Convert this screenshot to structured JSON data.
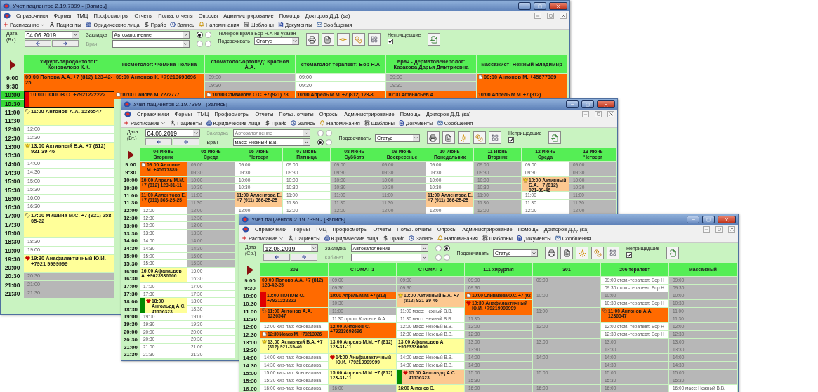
{
  "windows": [
    {
      "title": "Учет пациентов 2.19.7399 - [Запись]",
      "menu": [
        "Справочники",
        "Формы",
        "ТМЦ",
        "Профосмотры",
        "Отчеты",
        "Польз. отчеты",
        "Опросы",
        "Администрирование",
        "Помощь",
        "Докторов Д.Д. (sa)"
      ],
      "toolbar": [
        "Расписание",
        "Пациенты",
        "Юридические лица",
        "Прайс",
        "Запись",
        "Напоминания",
        "Шаблоны",
        "Документы",
        "Сообщения"
      ],
      "filter": {
        "date_label": "Дата",
        "weekday": "(Вт.)",
        "date": "04.06.2019",
        "fields": [
          {
            "label": "Закладка",
            "value": "Автозаполнение",
            "disabled": false
          },
          {
            "label": "Врач",
            "disabled": true
          }
        ],
        "radios": [
          [
            {
              "selected": true
            },
            {
              "selected": false
            }
          ],
          [
            {
              "selected": false
            },
            {
              "selected": false
            }
          ]
        ],
        "phone_note": "Телефон врача Бор Н.А не указан",
        "highlight_label": "Подсвечивать",
        "highlight_value": "Статус",
        "absent": {
          "label": "Неприщедшие",
          "checked": true
        }
      },
      "times": [
        {
          "t": "9:00",
          "selected": false
        },
        {
          "t": "9:30",
          "selected": false
        },
        {
          "t": "10:00",
          "selected": true
        },
        {
          "t": "10:30",
          "selected": true
        },
        {
          "t": "11:00",
          "selected": false
        },
        {
          "t": "11:30",
          "selected": false
        },
        {
          "t": "12:00",
          "selected": false
        },
        {
          "t": "12:30",
          "selected": false
        },
        {
          "t": "13:00",
          "selected": false
        },
        {
          "t": "13:30",
          "selected": false
        },
        {
          "t": "14:00",
          "selected": false
        },
        {
          "t": "14:30",
          "selected": false
        },
        {
          "t": "15:00",
          "selected": false
        },
        {
          "t": "15:30",
          "selected": false
        },
        {
          "t": "16:00",
          "selected": false
        },
        {
          "t": "16:30",
          "selected": false
        },
        {
          "t": "17:00",
          "selected": false
        },
        {
          "t": "17:30",
          "selected": false
        },
        {
          "t": "18:00",
          "selected": false
        },
        {
          "t": "18:30",
          "selected": false
        },
        {
          "t": "19:00",
          "selected": false
        },
        {
          "t": "19:30",
          "selected": false
        },
        {
          "t": "20:00",
          "selected": false
        },
        {
          "t": "20:30",
          "selected": false
        },
        {
          "t": "21:00",
          "selected": false
        },
        {
          "t": "21:30",
          "selected": false
        }
      ],
      "columns": [
        {
          "header": [
            "хирург-пародонтолог: Коновалова К.К."
          ],
          "cells": [
            {
              "kind": "visit",
              "text": "09:00 Попова А.А. +7 (812) 123-42-25",
              "color": "#ff6a00",
              "selected": false
            },
            {
              "kind": "visit",
              "text": "10:00 ПОПОВ О. +7921222222",
              "color": "#ff6a00",
              "selected": true,
              "flag": {
                "color": "#e00000"
              }
            },
            {
              "kind": "visit",
              "text": "11:00 Антонов А.А. 1236547",
              "color": "#ffff99",
              "selected": false,
              "tagged": true
            },
            {
              "kind": "free",
              "text": "12:00"
            },
            {
              "kind": "free",
              "text": "12:30"
            },
            {
              "kind": "visit",
              "text": "13:00 Активный Б.А. +7 (812) 921-39-46",
              "color": "#ffff99",
              "selected": false,
              "vip": true
            },
            {
              "kind": "free",
              "text": "14:00"
            },
            {
              "kind": "free",
              "text": "14:30"
            },
            {
              "kind": "free",
              "text": "15:00"
            },
            {
              "kind": "free",
              "text": "15:30"
            },
            {
              "kind": "free",
              "text": "16:00"
            },
            {
              "kind": "free",
              "text": "16:30"
            },
            {
              "kind": "visit-long",
              "text": "17:00 Мишина М.С. +7 (921) 258-05-22",
              "color": "#ffff99",
              "selected": false,
              "tagged": true
            },
            {
              "kind": "free",
              "text": "18:30"
            },
            {
              "kind": "free",
              "text": "19:00"
            },
            {
              "kind": "visit",
              "text": "19:30 Анафилактичный Ю.И. +7921 9999999",
              "color": "#ffff99",
              "selected": false,
              "allergy": true
            },
            {
              "kind": "closed",
              "text": "20:30"
            },
            {
              "kind": "closed",
              "text": "21:00"
            },
            {
              "kind": "closed",
              "text": "21:30"
            }
          ]
        },
        {
          "header": [
            "косметолог: Фомина Полина"
          ],
          "cells": [
            {
              "kind": "visit",
              "text": "09:00 Антонов К. +79213693696",
              "color": "#ff6a00",
              "selected": false
            },
            {
              "kind": "visit-half",
              "text": "10:00 Панова М. 7272777",
              "color": "#ff6a00",
              "selected": false,
              "noted": true
            }
          ]
        },
        {
          "header": [
            "стоматолог-ортопед: Краснов А.А."
          ],
          "cells": [
            {
              "kind": "closed",
              "text": "09:00"
            },
            {
              "kind": "closed",
              "text": "09:30"
            },
            {
              "kind": "visit-half",
              "text": "10:00 Спивакова О.С. +7 (921) 78",
              "color": "#ff6a00",
              "selected": false,
              "noted": true
            }
          ]
        },
        {
          "header": [
            "стоматолог-терапевт: Бор Н.А"
          ],
          "cells": [
            {
              "kind": "free",
              "text": "09:00"
            },
            {
              "kind": "free",
              "text": "09:30"
            },
            {
              "kind": "visit-half",
              "text": "10:00 Апрель М.М. +7 (812) 123-3",
              "color": "#ff6a00",
              "selected": false
            }
          ]
        },
        {
          "header": [
            "врач - дерматовенеролог: Казакова Дарья Дмитриевна"
          ],
          "cells": [
            {
              "kind": "closed",
              "text": "09:00"
            },
            {
              "kind": "closed",
              "text": "09:30"
            },
            {
              "kind": "visit-half",
              "text": "10:00 Афанасьев А.",
              "color": "#ff6a00",
              "selected": false
            }
          ]
        },
        {
          "header": [
            "массажист: Нежный Владимир"
          ],
          "cells": [
            {
              "kind": "visit",
              "text": "09:00 Антонов М. +45677889",
              "color": "#ff6a00",
              "selected": false,
              "noted": true
            },
            {
              "kind": "visit-half",
              "text": "10:00 Апрель М.М. +7 (812)",
              "color": "#ff6a00",
              "selected": false
            }
          ]
        }
      ]
    },
    {
      "title": "Учет пациентов 2.19.7399 - [Запись]",
      "menu": [
        "Справочники",
        "Формы",
        "ТМЦ",
        "Профосмотры",
        "Отчеты",
        "Польз. отчеты",
        "Опросы",
        "Администрирование",
        "Помощь",
        "Докторов Д.Д. (sa)"
      ],
      "toolbar": [
        "Расписание",
        "Пациенты",
        "Юридические лица",
        "Прайс",
        "Запись",
        "Напоминания",
        "Шаблоны",
        "Документы",
        "Сообщения"
      ],
      "filter": {
        "date_label": "Дата",
        "weekday": "(Вт.)",
        "date": "04.06.2019",
        "fields": [
          {
            "label": "Закладка",
            "value": "Автозаполнение",
            "disabled": true
          },
          {
            "label": "Врач",
            "value": "масс: Нежный В.В.",
            "disabled": false
          }
        ],
        "radios": [
          [
            {
              "selected": false
            },
            {
              "selected": false
            }
          ],
          [
            {
              "selected": true
            },
            {
              "selected": false
            }
          ]
        ],
        "highlight_label": "Подсвечивать",
        "highlight_value": "Статус",
        "absent": {
          "label": "Неприщедшие",
          "checked": true
        }
      },
      "times": [
        {
          "t": "9:00",
          "selected": false
        },
        {
          "t": "9:30",
          "selected": false
        },
        {
          "t": "10:00",
          "selected": false
        },
        {
          "t": "10:30",
          "selected": false
        },
        {
          "t": "11:00",
          "selected": false
        },
        {
          "t": "11:30",
          "selected": false
        },
        {
          "t": "12:00",
          "selected": false
        },
        {
          "t": "12:30",
          "selected": false
        },
        {
          "t": "13:00",
          "selected": false
        },
        {
          "t": "13:30",
          "selected": false
        },
        {
          "t": "14:00",
          "selected": false
        },
        {
          "t": "14:30",
          "selected": false
        },
        {
          "t": "15:00",
          "selected": false
        },
        {
          "t": "15:30",
          "selected": false
        },
        {
          "t": "16:00",
          "selected": false
        },
        {
          "t": "16:30",
          "selected": false
        },
        {
          "t": "17:00",
          "selected": false
        },
        {
          "t": "17:30",
          "selected": false
        },
        {
          "t": "18:00",
          "selected": false
        },
        {
          "t": "18:30",
          "selected": false
        },
        {
          "t": "19:00",
          "selected": false
        },
        {
          "t": "19:30",
          "selected": false
        },
        {
          "t": "20:00",
          "selected": false
        },
        {
          "t": "20:30",
          "selected": false
        },
        {
          "t": "21:00",
          "selected": false
        },
        {
          "t": "21:30",
          "selected": false
        }
      ],
      "columns": [
        {
          "header": [
            "04 Июнь",
            "Вторник"
          ],
          "cells": [
            {
              "kind": "visit",
              "text": "09:00 Антонов М. +45677889",
              "color": "#ff6a00",
              "selected": false,
              "noted": true
            },
            {
              "kind": "visit",
              "text": "10:00 Апрель М.М. +7 (812) 123-31-11",
              "color": "#ff6a00",
              "selected": false
            },
            {
              "kind": "visit",
              "text": "11:00 Аллентова Е. +7 (911) 366-25-25",
              "color": "#ff6a00",
              "selected": false
            },
            {
              "kind": "free",
              "text": "12:00"
            },
            {
              "kind": "free",
              "text": "12:30"
            },
            {
              "kind": "free",
              "text": "13:00"
            },
            {
              "kind": "free",
              "text": "13:30"
            },
            {
              "kind": "free",
              "text": "14:00"
            },
            {
              "kind": "free",
              "text": "14:30"
            },
            {
              "kind": "free",
              "text": "15:00"
            },
            {
              "kind": "free",
              "text": "15:30"
            },
            {
              "kind": "visit",
              "text": "16:00 Афанасьев А. +9623336666",
              "color": "#ffff99",
              "selected": false
            },
            {
              "kind": "free",
              "text": "17:00"
            },
            {
              "kind": "free",
              "text": "17:30"
            },
            {
              "kind": "visit",
              "text": "18:00 Ангольдц А.С. 41156323",
              "color": "#ffff99",
              "selected": false,
              "allergy": true,
              "flag": {
                "color": "#008a00"
              }
            },
            {
              "kind": "free",
              "text": "19:00"
            },
            {
              "kind": "free",
              "text": "19:30"
            },
            {
              "kind": "free",
              "text": "20:00"
            },
            {
              "kind": "free",
              "text": "20:30"
            },
            {
              "kind": "free",
              "text": "21:00"
            },
            {
              "kind": "free",
              "text": "21:30"
            }
          ]
        },
        {
          "header": [
            "05 Июнь",
            "Среда"
          ],
          "cells": [
            {
              "kind": "closed",
              "text": "09:00"
            },
            {
              "kind": "closed",
              "text": "09:30"
            },
            {
              "kind": "closed",
              "text": "10:00"
            },
            {
              "kind": "closed",
              "text": "10:30"
            },
            {
              "kind": "closed",
              "text": "11:00"
            },
            {
              "kind": "closed",
              "text": "11:30"
            },
            {
              "kind": "closed",
              "text": "12:00"
            },
            {
              "kind": "closed",
              "text": "12:30"
            },
            {
              "kind": "closed",
              "text": "13:00"
            },
            {
              "kind": "closed",
              "text": "13:30"
            },
            {
              "kind": "closed",
              "text": "14:00"
            },
            {
              "kind": "closed",
              "text": "14:30"
            },
            {
              "kind": "closed",
              "text": "15:00"
            },
            {
              "kind": "closed",
              "text": "15:30"
            },
            {
              "kind": "free",
              "text": "16:00"
            },
            {
              "kind": "free",
              "text": "16:30"
            },
            {
              "kind": "free",
              "text": "17:00"
            },
            {
              "kind": "free",
              "text": "17:30"
            },
            {
              "kind": "free",
              "text": "18:00"
            },
            {
              "kind": "free",
              "text": "18:30"
            },
            {
              "kind": "free",
              "text": "19:00"
            },
            {
              "kind": "free",
              "text": "19:30"
            },
            {
              "kind": "free",
              "text": "20:00"
            },
            {
              "kind": "free",
              "text": "20:30"
            },
            {
              "kind": "free",
              "text": "21:00"
            },
            {
              "kind": "free",
              "text": "21:30"
            }
          ]
        },
        {
          "header": [
            "06 Июнь",
            "Четверг"
          ],
          "cells": [
            {
              "kind": "free",
              "text": "09:00"
            },
            {
              "kind": "free",
              "text": "09:30"
            },
            {
              "kind": "free",
              "text": "10:00"
            },
            {
              "kind": "free",
              "text": "10:30"
            },
            {
              "kind": "visit",
              "text": "11:00 Аллентова Е. +7 (911) 366-25-25",
              "color": "#fcc890",
              "selected": false
            },
            {
              "kind": "free",
              "text": "12:00"
            }
          ]
        },
        {
          "header": [
            "07 Июнь",
            "Пятница"
          ],
          "cells": [
            {
              "kind": "free",
              "text": "09:00"
            },
            {
              "kind": "free",
              "text": "09:30"
            },
            {
              "kind": "free",
              "text": "10:00"
            },
            {
              "kind": "free",
              "text": "10:30"
            },
            {
              "kind": "free",
              "text": "11:00"
            },
            {
              "kind": "free",
              "text": "11:30"
            },
            {
              "kind": "free",
              "text": "12:00"
            }
          ]
        },
        {
          "header": [
            "08 Июнь",
            "Суббота"
          ],
          "cells": [
            {
              "kind": "closed",
              "text": "09:00"
            },
            {
              "kind": "closed",
              "text": "09:30"
            },
            {
              "kind": "closed",
              "text": "10:00"
            },
            {
              "kind": "closed",
              "text": "10:30"
            },
            {
              "kind": "closed",
              "text": "11:00"
            },
            {
              "kind": "closed",
              "text": "11:30"
            },
            {
              "kind": "closed",
              "text": "12:00"
            }
          ]
        },
        {
          "header": [
            "09 Июнь",
            "Воскресенье"
          ],
          "cells": [
            {
              "kind": "closed",
              "text": "09:00"
            },
            {
              "kind": "closed",
              "text": "09:30"
            },
            {
              "kind": "closed",
              "text": "10:00"
            },
            {
              "kind": "closed",
              "text": "10:30"
            },
            {
              "kind": "closed",
              "text": "11:00"
            },
            {
              "kind": "closed",
              "text": "11:30"
            },
            {
              "kind": "closed",
              "text": "12:00"
            }
          ]
        },
        {
          "header": [
            "10 Июнь",
            "Понедельник"
          ],
          "cells": [
            {
              "kind": "free",
              "text": "09:00"
            },
            {
              "kind": "free",
              "text": "09:30"
            },
            {
              "kind": "free",
              "text": "10:00"
            },
            {
              "kind": "free",
              "text": "10:30"
            },
            {
              "kind": "visit",
              "text": "11:00 Аллентова Е. +7 (911) 366-25-25",
              "color": "#fcc890",
              "selected": false
            },
            {
              "kind": "free",
              "text": "12:00"
            }
          ]
        },
        {
          "header": [
            "11 Июнь",
            "Вторник"
          ],
          "cells": [
            {
              "kind": "closed",
              "text": "09:00"
            },
            {
              "kind": "closed",
              "text": "09:30"
            },
            {
              "kind": "closed",
              "text": "10:00"
            },
            {
              "kind": "closed",
              "text": "10:30"
            },
            {
              "kind": "closed",
              "text": "11:00"
            },
            {
              "kind": "closed",
              "text": "11:30"
            },
            {
              "kind": "closed",
              "text": "12:00"
            }
          ]
        },
        {
          "header": [
            "12 Июнь",
            "Среда"
          ],
          "cells": [
            {
              "kind": "free",
              "text": "09:00"
            },
            {
              "kind": "free",
              "text": "09:30"
            },
            {
              "kind": "visit",
              "text": "10:00 Активный Б.А. +7 (812) 921-39-46",
              "color": "#fcc890",
              "selected": false,
              "vip": true
            },
            {
              "kind": "free",
              "text": "11:00"
            },
            {
              "kind": "free",
              "text": "11:30"
            },
            {
              "kind": "free",
              "text": "12:00"
            }
          ]
        },
        {
          "header": [
            "13 Июнь",
            "Четверг"
          ],
          "cells": [
            {
              "kind": "closed",
              "text": "09:00"
            },
            {
              "kind": "closed",
              "text": "09:30"
            },
            {
              "kind": "closed",
              "text": "10:00"
            },
            {
              "kind": "closed",
              "text": "10:30"
            },
            {
              "kind": "closed",
              "text": "11:00"
            },
            {
              "kind": "closed",
              "text": "11:30"
            },
            {
              "kind": "closed",
              "text": "12:00"
            }
          ]
        }
      ]
    },
    {
      "title": "Учет пациентов 2.19.7399 - [Запись]",
      "menu": [
        "Справочники",
        "Формы",
        "ТМЦ",
        "Профосмотры",
        "Отчеты",
        "Польз. отчеты",
        "Опросы",
        "Администрирование",
        "Помощь",
        "Докторов Д.Д. (sa)"
      ],
      "toolbar": [
        "Расписание",
        "Пациенты",
        "Юридические лица",
        "Прайс",
        "Запись",
        "Напоминания",
        "Шаблоны",
        "Документы",
        "Сообщения"
      ],
      "filter": {
        "date_label": "Дата",
        "weekday": "(Ср.)",
        "date": "12.06.2019",
        "fields": [
          {
            "label": "Закладка",
            "value": "Автозаполнение",
            "disabled": false
          },
          {
            "label": "Кабинет",
            "disabled": true
          }
        ],
        "radios": [
          [
            {
              "selected": false
            },
            {
              "selected": true
            }
          ],
          [
            {
              "selected": false
            },
            {
              "selected": false
            }
          ]
        ],
        "highlight_label": "Подсвечивать",
        "highlight_value": "Статус",
        "absent": {
          "label": "Неприщедшие",
          "checked": true
        }
      },
      "times": [
        {
          "t": "9:00",
          "selected": false
        },
        {
          "t": "9:30",
          "selected": false
        },
        {
          "t": "10:00",
          "selected": false
        },
        {
          "t": "10:30",
          "selected": false
        },
        {
          "t": "11:00",
          "selected": false
        },
        {
          "t": "11:30",
          "selected": false
        },
        {
          "t": "12:00",
          "selected": false
        },
        {
          "t": "12:30",
          "selected": false
        },
        {
          "t": "13:00",
          "selected": false
        },
        {
          "t": "13:30",
          "selected": false
        },
        {
          "t": "14:00",
          "selected": false
        },
        {
          "t": "14:30",
          "selected": false
        },
        {
          "t": "15:00",
          "selected": false
        },
        {
          "t": "15:30",
          "selected": false
        },
        {
          "t": "16:00",
          "selected": false
        }
      ],
      "columns": [
        {
          "header": [
            "203"
          ],
          "cells": [
            {
              "kind": "visit",
              "text": "09:00 Попова А.А. +7 (812) 123-42-25",
              "color": "#ff6a00",
              "selected": false
            },
            {
              "kind": "visit",
              "text": "10:00 ПОПОВ О. +7921222222",
              "color": "#ff6a00",
              "selected": false,
              "flag": {
                "color": "#e00000"
              }
            },
            {
              "kind": "visit",
              "text": "11:00 Антонов А.А. 1236547",
              "color": "#ff6a00",
              "selected": false,
              "tagged": true
            },
            {
              "kind": "free",
              "text": "12:00 хир-пар: Коновалова"
            },
            {
              "kind": "visit-half",
              "text": "12:30 Исаев М. +79213926",
              "color": "#ff6a00",
              "selected": false,
              "noted": true
            },
            {
              "kind": "visit",
              "text": "13:00 Активный Б.А. +7 (812) 921-39-46",
              "color": "#ffff99",
              "selected": false,
              "vip": true
            },
            {
              "kind": "free",
              "text": "14:00 хир-пар: Коновалова"
            },
            {
              "kind": "free",
              "text": "14:30 хир-пар: Коновалова"
            },
            {
              "kind": "free",
              "text": "15:00 хир-пар: Коновалова"
            },
            {
              "kind": "free",
              "text": "15:30 хир-пар: Коновалова"
            },
            {
              "kind": "free",
              "text": "16:00 хир-пар: Коновалова"
            }
          ]
        },
        {
          "header": [
            "СТОМАТ 1"
          ],
          "cells": [
            {
              "kind": "closed",
              "text": "09:00"
            },
            {
              "kind": "closed",
              "text": "09:30"
            },
            {
              "kind": "visit-half",
              "text": "10:00 Апрель М.М. +7 (812)",
              "color": "#ff6a00",
              "selected": false
            },
            {
              "kind": "closed",
              "text": "10:30"
            },
            {
              "kind": "closed",
              "text": "11:00"
            },
            {
              "kind": "free",
              "text": "11:30 ортоп: Краснов А.А."
            },
            {
              "kind": "visit",
              "text": "12:00 Антонов С. +79213693696",
              "color": "#ff6a00",
              "selected": false
            },
            {
              "kind": "visit",
              "text": "13:00 Апрель М.М. +7 (812) 123-31-11",
              "color": "#ffff99",
              "selected": false
            },
            {
              "kind": "visit",
              "text": "14:00 Анафилактичный Ю.И. +79219999999",
              "color": "#ffff99",
              "selected": false,
              "allergy": true
            },
            {
              "kind": "visit",
              "text": "15:00 Апрель М.М. +7 (812) 123-31-11",
              "color": "#ffff99",
              "selected": false
            },
            {
              "kind": "closed",
              "text": "16:00"
            }
          ]
        },
        {
          "header": [
            "СТОМАТ 2"
          ],
          "cells": [
            {
              "kind": "closed",
              "text": "09:00"
            },
            {
              "kind": "closed",
              "text": "09:30"
            },
            {
              "kind": "visit",
              "text": "10:00 Активный Б.А. +7 (812) 921-39-46",
              "color": "#fcc890",
              "selected": false,
              "vip": true
            },
            {
              "kind": "free",
              "text": "11:00 масс: Нежный В.В."
            },
            {
              "kind": "free",
              "text": "11:30 масс: Нежный В.В."
            },
            {
              "kind": "free",
              "text": "12:00 масс: Нежный В.В."
            },
            {
              "kind": "free",
              "text": "12:30 масс: Нежный В.В."
            },
            {
              "kind": "visit",
              "text": "13:00 Афанасьев А. +9623336666",
              "color": "#ffff99",
              "selected": false
            },
            {
              "kind": "free",
              "text": "14:00 масс: Нежный В.В."
            },
            {
              "kind": "free",
              "text": "14:30 масс: Нежный В.В."
            },
            {
              "kind": "visit",
              "text": "15:00 Ангольдц А.С. 41156323",
              "color": "#fcc890",
              "selected": false,
              "allergy": true,
              "flag": {
                "color": "#008a00"
              }
            },
            {
              "kind": "visit-half",
              "text": "16:00 Антонов С.",
              "color": "#ffff99",
              "selected": false
            }
          ]
        },
        {
          "header": [
            "111-хирургия"
          ],
          "cells": [
            {
              "kind": "closed",
              "text": "09:00"
            },
            {
              "kind": "closed",
              "text": "09:30"
            },
            {
              "kind": "visit-half",
              "text": "10:00 Спивакова О.С. +7 (92",
              "color": "#ff6a00",
              "selected": false,
              "noted": true
            },
            {
              "kind": "visit",
              "text": "10:30 Анафилактичный Ю.И. +79219999999",
              "color": "#ff6a00",
              "selected": false,
              "allergy": true
            },
            {
              "kind": "closed",
              "text": "11:30"
            },
            {
              "kind": "closed",
              "text": "12:00"
            },
            {
              "kind": "closed",
              "text": "12:30"
            },
            {
              "kind": "closed",
              "text": "13:00"
            },
            {
              "kind": "closed",
              "text": "13:30"
            },
            {
              "kind": "closed",
              "text": "14:00"
            },
            {
              "kind": "closed",
              "text": "14:30"
            },
            {
              "kind": "closed",
              "text": "15:00"
            },
            {
              "kind": "closed",
              "text": "15:30"
            },
            {
              "kind": "closed",
              "text": "16:00"
            }
          ]
        },
        {
          "header": [
            "301"
          ],
          "cells": [
            {
              "kind": "closed-hour",
              "text": "09:00"
            },
            {
              "kind": "closed-hour",
              "text": "10:00"
            },
            {
              "kind": "closed-hour",
              "text": "11:00"
            },
            {
              "kind": "closed-hour",
              "text": "12:00"
            },
            {
              "kind": "closed-hour",
              "text": "13:00"
            },
            {
              "kind": "closed-hour",
              "text": "14:00"
            },
            {
              "kind": "closed-hour",
              "text": "15:00"
            },
            {
              "kind": "closed",
              "text": "16:00"
            }
          ]
        },
        {
          "header": [
            "206 терапевт"
          ],
          "cells": [
            {
              "kind": "free",
              "text": "09:00 стом.-терапевт: Бор Н"
            },
            {
              "kind": "free",
              "text": "09:30 стом.-терапевт: Бор Н"
            },
            {
              "kind": "closed",
              "text": "10:00"
            },
            {
              "kind": "free",
              "text": "10:30 стом.-терапевт: Бор Н"
            },
            {
              "kind": "visit",
              "text": "11:00 Антонов А.А. 1236547",
              "color": "#ff6a00",
              "selected": false,
              "tagged": true
            },
            {
              "kind": "free",
              "text": "12:00 стом.-терапевт: Бор Н"
            },
            {
              "kind": "free",
              "text": "12:30 стом.-терапевт: Бор Н"
            },
            {
              "kind": "closed",
              "text": "13:00"
            },
            {
              "kind": "closed",
              "text": "13:30"
            },
            {
              "kind": "closed",
              "text": "14:00"
            },
            {
              "kind": "closed",
              "text": "14:30"
            },
            {
              "kind": "closed",
              "text": "15:00"
            },
            {
              "kind": "closed",
              "text": "15:30"
            },
            {
              "kind": "closed",
              "text": "16:00"
            }
          ]
        },
        {
          "header": [
            "Массажный"
          ],
          "cells": [
            {
              "kind": "closed",
              "text": "09:00"
            },
            {
              "kind": "closed",
              "text": "09:30"
            },
            {
              "kind": "closed",
              "text": "10:00"
            },
            {
              "kind": "closed",
              "text": "10:30"
            },
            {
              "kind": "closed",
              "text": "11:00"
            },
            {
              "kind": "closed",
              "text": "11:30"
            },
            {
              "kind": "closed",
              "text": "12:00"
            },
            {
              "kind": "closed",
              "text": "12:30"
            },
            {
              "kind": "closed",
              "text": "13:00"
            },
            {
              "kind": "closed",
              "text": "13:30"
            },
            {
              "kind": "closed",
              "text": "14:00"
            },
            {
              "kind": "closed",
              "text": "14:30"
            },
            {
              "kind": "closed",
              "text": "15:00"
            },
            {
              "kind": "closed",
              "text": "15:30"
            },
            {
              "kind": "free",
              "text": "16:00 масс: Нежный В.В."
            }
          ]
        }
      ]
    }
  ]
}
